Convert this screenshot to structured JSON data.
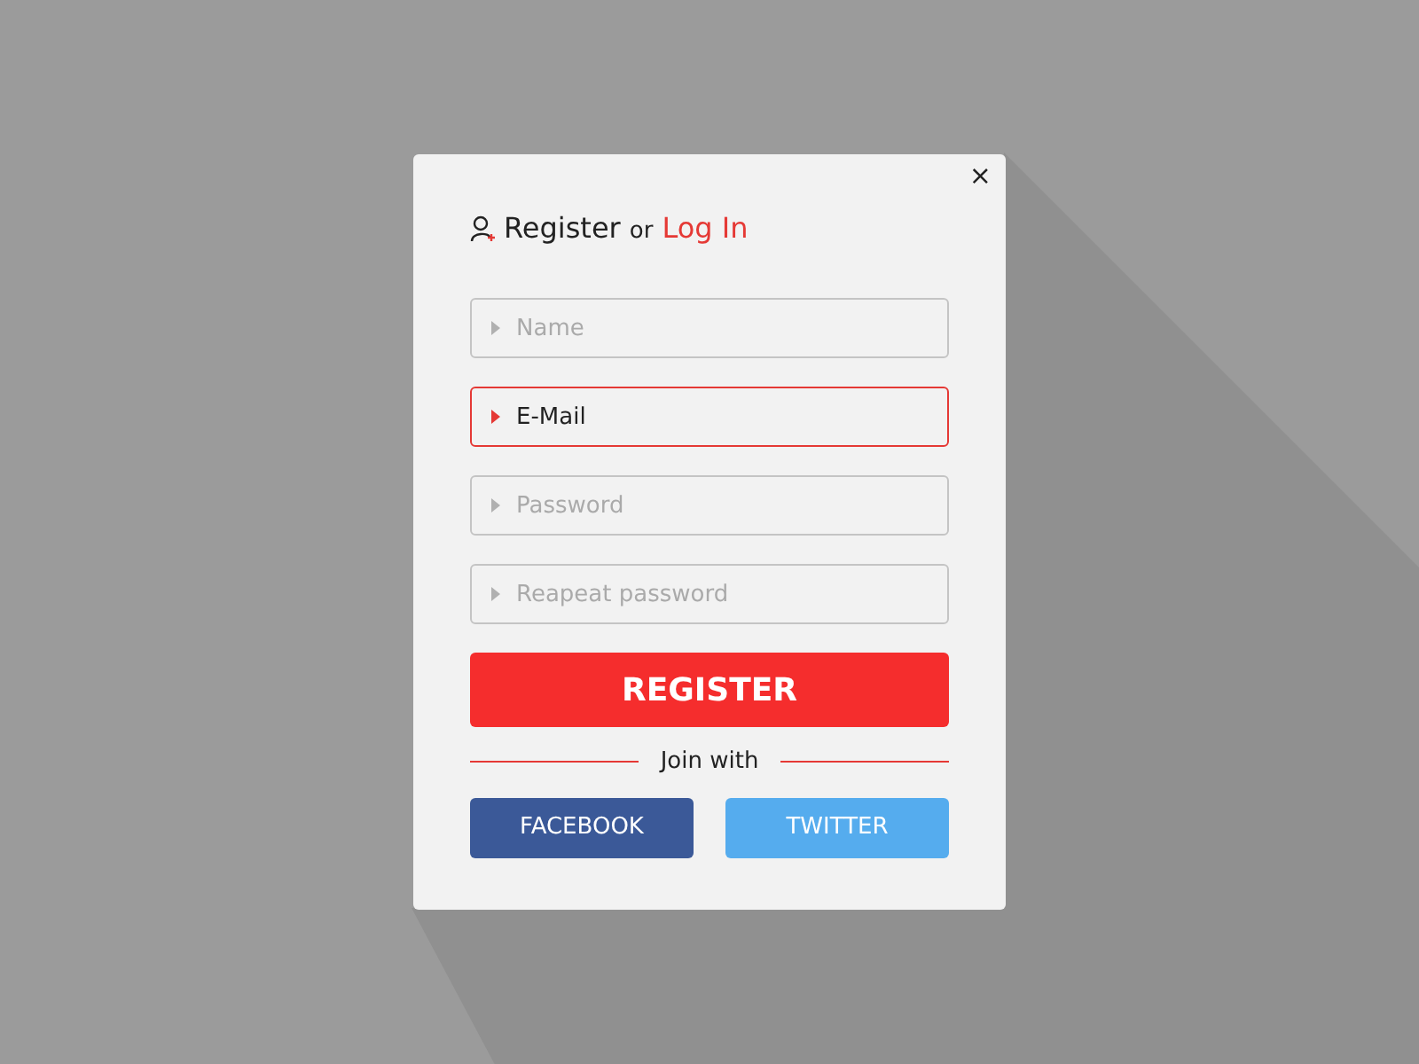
{
  "dialog": {
    "close": "×",
    "title": {
      "main": "Register",
      "joiner": "or",
      "link": "Log In"
    },
    "fields": [
      {
        "placeholder": "Name",
        "focused": false
      },
      {
        "placeholder": "E-Mail",
        "focused": true
      },
      {
        "placeholder": "Password",
        "focused": false
      },
      {
        "placeholder": "Reapeat password",
        "focused": false
      }
    ],
    "submit": "REGISTER",
    "divider": "Join with",
    "social": [
      {
        "label": "FACEBOOK",
        "color": "#3b5998"
      },
      {
        "label": "TWITTER",
        "color": "#55acee"
      }
    ]
  }
}
